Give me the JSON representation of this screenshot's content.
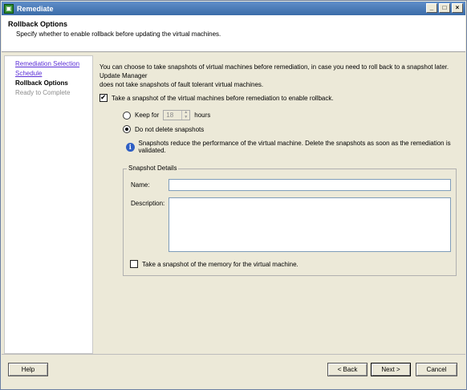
{
  "window": {
    "title": "Remediate",
    "controls": [
      "_",
      "□",
      "×"
    ]
  },
  "header": {
    "title": "Rollback Options",
    "subtitle": "Specify whether to enable rollback before updating the virtual machines."
  },
  "nav": {
    "items": [
      {
        "label": "Remediation Selection",
        "state": "link"
      },
      {
        "label": "Schedule",
        "state": "link"
      },
      {
        "label": "Rollback Options",
        "state": "current"
      },
      {
        "label": "Ready to Complete",
        "state": "disabled"
      }
    ]
  },
  "content": {
    "intro_line1": "You can choose to take snapshots of virtual machines before remediation, in case you need to roll back to a snapshot later. Update Manager",
    "intro_line2": "does not take snapshots of fault tolerant virtual machines.",
    "take_snapshot_label": "Take a snapshot of the virtual machines before remediation to enable rollback.",
    "take_snapshot_checked": true,
    "keep_for_label": "Keep for",
    "keep_for_value": "18",
    "hours_label": "hours",
    "do_not_delete_label": "Do not delete snapshots",
    "selected_option": "do_not_delete",
    "info_text": "Snapshots reduce the performance of the virtual machine. Delete the snapshots as soon as the remediation is validated.",
    "snapshot_details": {
      "group_title": "Snapshot Details",
      "name_label": "Name:",
      "name_value": "",
      "description_label": "Description:",
      "description_value": "",
      "memory_label": "Take a snapshot of the memory for the virtual machine.",
      "memory_checked": false
    }
  },
  "footer": {
    "help_label": "Help",
    "back_label": "< Back",
    "next_label": "Next >",
    "cancel_label": "Cancel"
  },
  "colors": {
    "titlebar": "#3b6ca8",
    "link": "#5a2dd6",
    "dialog_bg": "#ece9d8"
  }
}
